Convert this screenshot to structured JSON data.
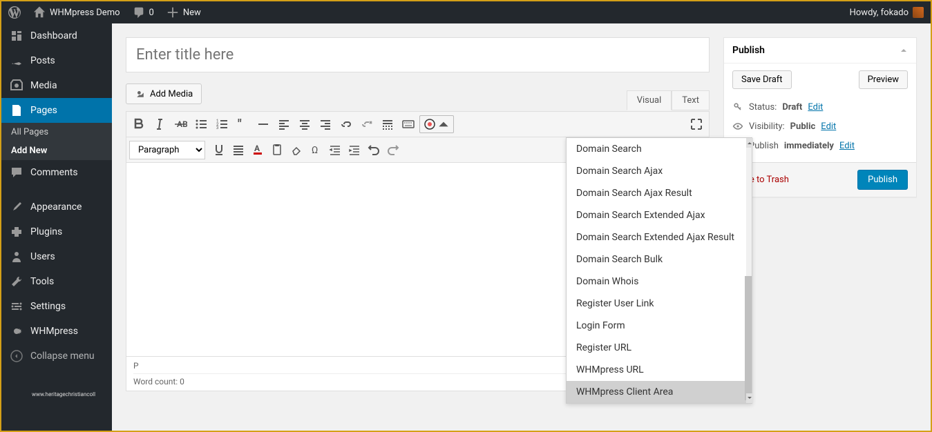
{
  "adminBar": {
    "siteName": "WHMpress Demo",
    "comments": "0",
    "newLabel": "New",
    "greeting": "Howdy, fokado"
  },
  "sidebar": {
    "items": [
      {
        "label": "Dashboard",
        "icon": "dashboard"
      },
      {
        "label": "Posts",
        "icon": "pin"
      },
      {
        "label": "Media",
        "icon": "media"
      },
      {
        "label": "Pages",
        "icon": "pages",
        "active": true
      },
      {
        "label": "Comments",
        "icon": "comments"
      },
      {
        "label": "Appearance",
        "icon": "brush"
      },
      {
        "label": "Plugins",
        "icon": "plugin"
      },
      {
        "label": "Users",
        "icon": "users"
      },
      {
        "label": "Tools",
        "icon": "tools"
      },
      {
        "label": "Settings",
        "icon": "settings"
      },
      {
        "label": "WHMpress",
        "icon": "gear"
      }
    ],
    "subitems": [
      {
        "label": "All Pages"
      },
      {
        "label": "Add New",
        "active": true
      }
    ],
    "collapse": "Collapse menu"
  },
  "editor": {
    "titlePlaceholder": "Enter title here",
    "addMedia": "Add Media",
    "tabs": {
      "visual": "Visual",
      "text": "Text"
    },
    "paragraphLabel": "Paragraph",
    "statusPath": "P",
    "wordCount": "Word count: 0"
  },
  "dropdown": {
    "items": [
      "Domain Search",
      "Domain Search Ajax",
      "Domain Search Ajax Result",
      "Domain Search Extended Ajax",
      "Domain Search Extended Ajax Result",
      "Domain Search Bulk",
      "Domain Whois",
      "Register User Link",
      "Login Form",
      "Register URL",
      "WHMpress URL",
      "WHMpress Client Area"
    ],
    "highlightedIndex": 11
  },
  "publish": {
    "title": "Publish",
    "saveDraft": "Save Draft",
    "preview": "Preview",
    "statusLabel": "Status:",
    "statusValue": "Draft",
    "visibilityLabel": "Visibility:",
    "visibilityValue": "Public",
    "publishLabel": "Publish",
    "publishValue": "immediately",
    "editLink": "Edit",
    "trash": "Move to Trash",
    "publishBtn": "Publish"
  },
  "footer": "www.heritagechristiancoll"
}
